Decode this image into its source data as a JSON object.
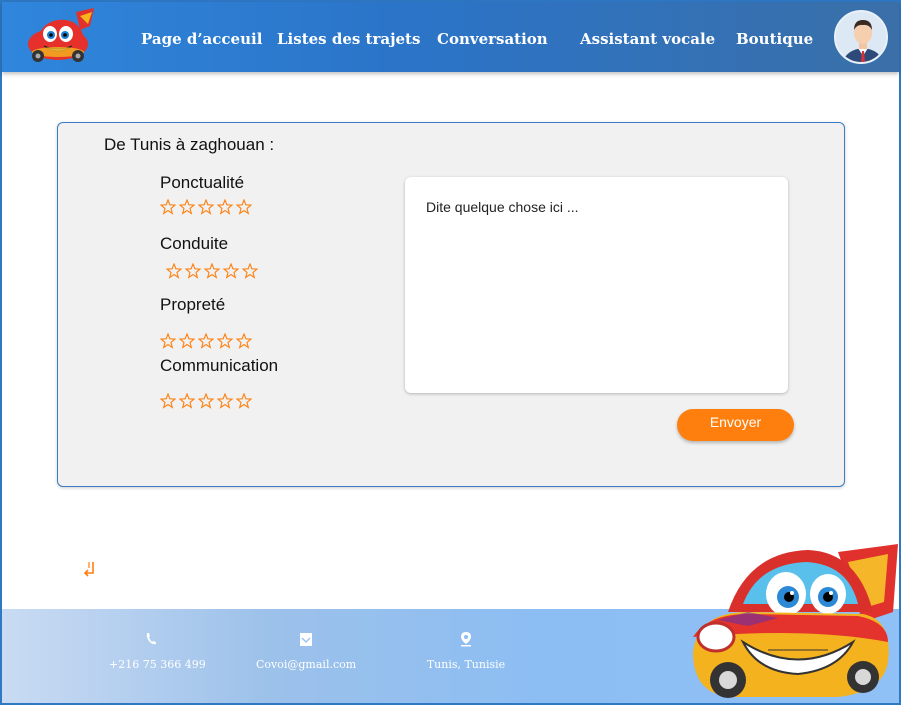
{
  "header": {
    "nav": [
      {
        "label": "Page d’acceuil"
      },
      {
        "label": "Listes des trajets"
      },
      {
        "label": "Conversation"
      },
      {
        "label": "Assistant vocale"
      },
      {
        "label": "Boutique"
      }
    ]
  },
  "review": {
    "route_title": "De Tunis à zaghouan :",
    "criteria": [
      {
        "label": "Ponctualité",
        "rating": 0,
        "max": 5
      },
      {
        "label": "Conduite",
        "rating": 0,
        "max": 5
      },
      {
        "label": "Propreté",
        "rating": 0,
        "max": 5
      },
      {
        "label": "Communication",
        "rating": 0,
        "max": 5
      }
    ],
    "comment_placeholder": "Dite quelque chose ici ...",
    "send_label": "Envoyer"
  },
  "footer": {
    "phone": "+216 75 366 499",
    "email": "Covoi@gmail.com",
    "location": "Tunis, Tunisie"
  },
  "colors": {
    "accent": "#ff7f0e",
    "header": "#2b74c8",
    "card_border": "#3b7cc2"
  }
}
